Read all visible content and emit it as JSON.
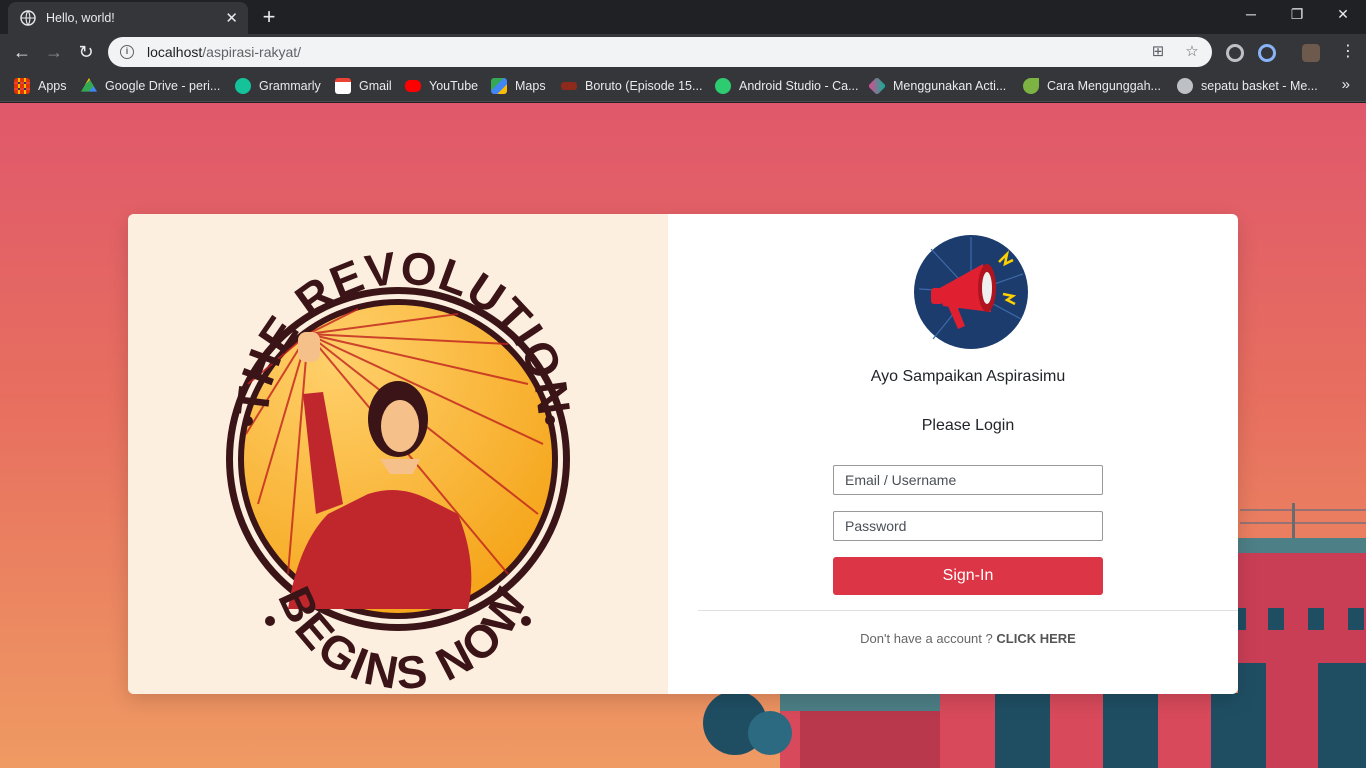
{
  "browser": {
    "tab_title": "Hello, world!",
    "url_host": "localhost",
    "url_path": "/aspirasi-rakyat/",
    "bookmarks": [
      {
        "label": "Apps",
        "icon": "apps-grid-icon",
        "color": "#ea4335"
      },
      {
        "label": "Google Drive - peri...",
        "icon": "google-drive-icon",
        "color": "#34a853"
      },
      {
        "label": "Grammarly",
        "icon": "grammarly-icon",
        "color": "#15c39a"
      },
      {
        "label": "Gmail",
        "icon": "gmail-icon",
        "color": "#ea4335"
      },
      {
        "label": "YouTube",
        "icon": "youtube-icon",
        "color": "#ff0000"
      },
      {
        "label": "Maps",
        "icon": "maps-icon",
        "color": "#4285f4"
      },
      {
        "label": "Boruto (Episode 15...",
        "icon": "boruto-icon",
        "color": "#c0392b"
      },
      {
        "label": "Android Studio - Ca...",
        "icon": "android-studio-icon",
        "color": "#2ecc71"
      },
      {
        "label": "Menggunakan Acti...",
        "icon": "app-icon",
        "color": "#e84393"
      },
      {
        "label": "Cara Mengunggah...",
        "icon": "leaf-icon",
        "color": "#7cb342"
      },
      {
        "label": "sepatu basket - Me...",
        "icon": "globe-icon",
        "color": "#bdc1c6"
      }
    ]
  },
  "page": {
    "poster": {
      "top_text": "THE REVOLUTION",
      "bottom_text": "BEGINS NOW"
    },
    "tagline": "Ayo Sampaikan Aspirasimu",
    "heading": "Please Login",
    "email_placeholder": "Email / Username",
    "password_placeholder": "Password",
    "signin_label": "Sign-In",
    "signup_prompt": "Don't have a account ?",
    "signup_link": "CLICK HERE",
    "accent_color": "#dc3545"
  }
}
